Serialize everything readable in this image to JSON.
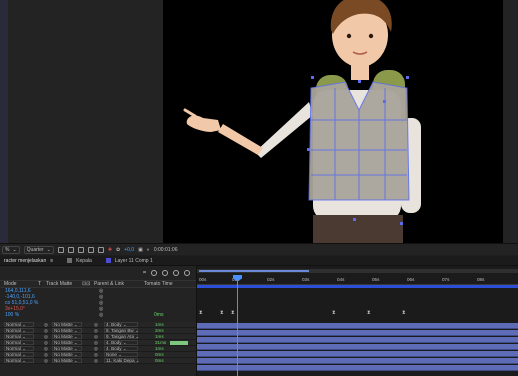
{
  "viewer": {
    "colors": {
      "canvas": "#000000",
      "skin": "#f2c9a8",
      "shirt": "#e9e3dd",
      "vest": "#a9a39b",
      "backpack": "#8a9a4a",
      "hair": "#7a4a25",
      "pants": "#4a3a32",
      "selection": "#5a6cf0"
    }
  },
  "toolbar": {
    "zoom": "%",
    "resolution": "Quarter",
    "exposure": "+0,0",
    "timecode": "0:00:01:06"
  },
  "tabs": [
    {
      "label": "racter menjelaskan",
      "close": "≡",
      "color": "#6d6d6d",
      "active": true
    },
    {
      "label": "Kepala",
      "close": "",
      "color": "#6d6d6d",
      "active": false
    },
    {
      "label": "Layer 11 Comp 1",
      "close": "",
      "color": "#4b4bd6",
      "active": false
    }
  ],
  "layer_panel": {
    "columns": {
      "mode": "Mode",
      "t": "T",
      "trkmat": "Track Matte",
      "parent": "Parent & Link",
      "stretch": "Tomato Time"
    },
    "properties": [
      {
        "value": "164,0,111,6",
        "color": "#4aa3ff"
      },
      {
        "value": "-140,0,-101,6",
        "color": "#4aa3ff"
      },
      {
        "value": "co 51,0,51,0 %",
        "color": "#4aa3ff"
      },
      {
        "value": "3x+15,0°",
        "color": "#e3554a"
      },
      {
        "value": "100 %",
        "color": "#4aa3ff"
      }
    ],
    "layers": [
      {
        "mode": "Normal",
        "matte": "No Matte",
        "parent": "4. Body",
        "duration": "1ms"
      },
      {
        "mode": "Normal",
        "matte": "No Matte",
        "parent": "8. Tangan Bw",
        "duration": "2ms"
      },
      {
        "mode": "Normal",
        "matte": "No Matte",
        "parent": "9. Tangan Ata",
        "duration": "1ms"
      },
      {
        "mode": "Normal",
        "matte": "No Matte",
        "parent": "4. Body",
        "duration": "31ms"
      },
      {
        "mode": "Normal",
        "matte": "No Matte",
        "parent": "4. Body",
        "duration": "1ms"
      },
      {
        "mode": "Normal",
        "matte": "No Matte",
        "parent": "None",
        "duration": "0ms"
      },
      {
        "mode": "Normal",
        "matte": "No Matte",
        "parent": "11. Kaki Depa",
        "duration": "0ms"
      }
    ],
    "selected_duration": "0ms"
  },
  "ruler": {
    "labels": [
      "00s",
      "01s",
      "02s",
      "03s",
      "04s",
      "05s",
      "06s",
      "07s",
      "08s"
    ]
  }
}
